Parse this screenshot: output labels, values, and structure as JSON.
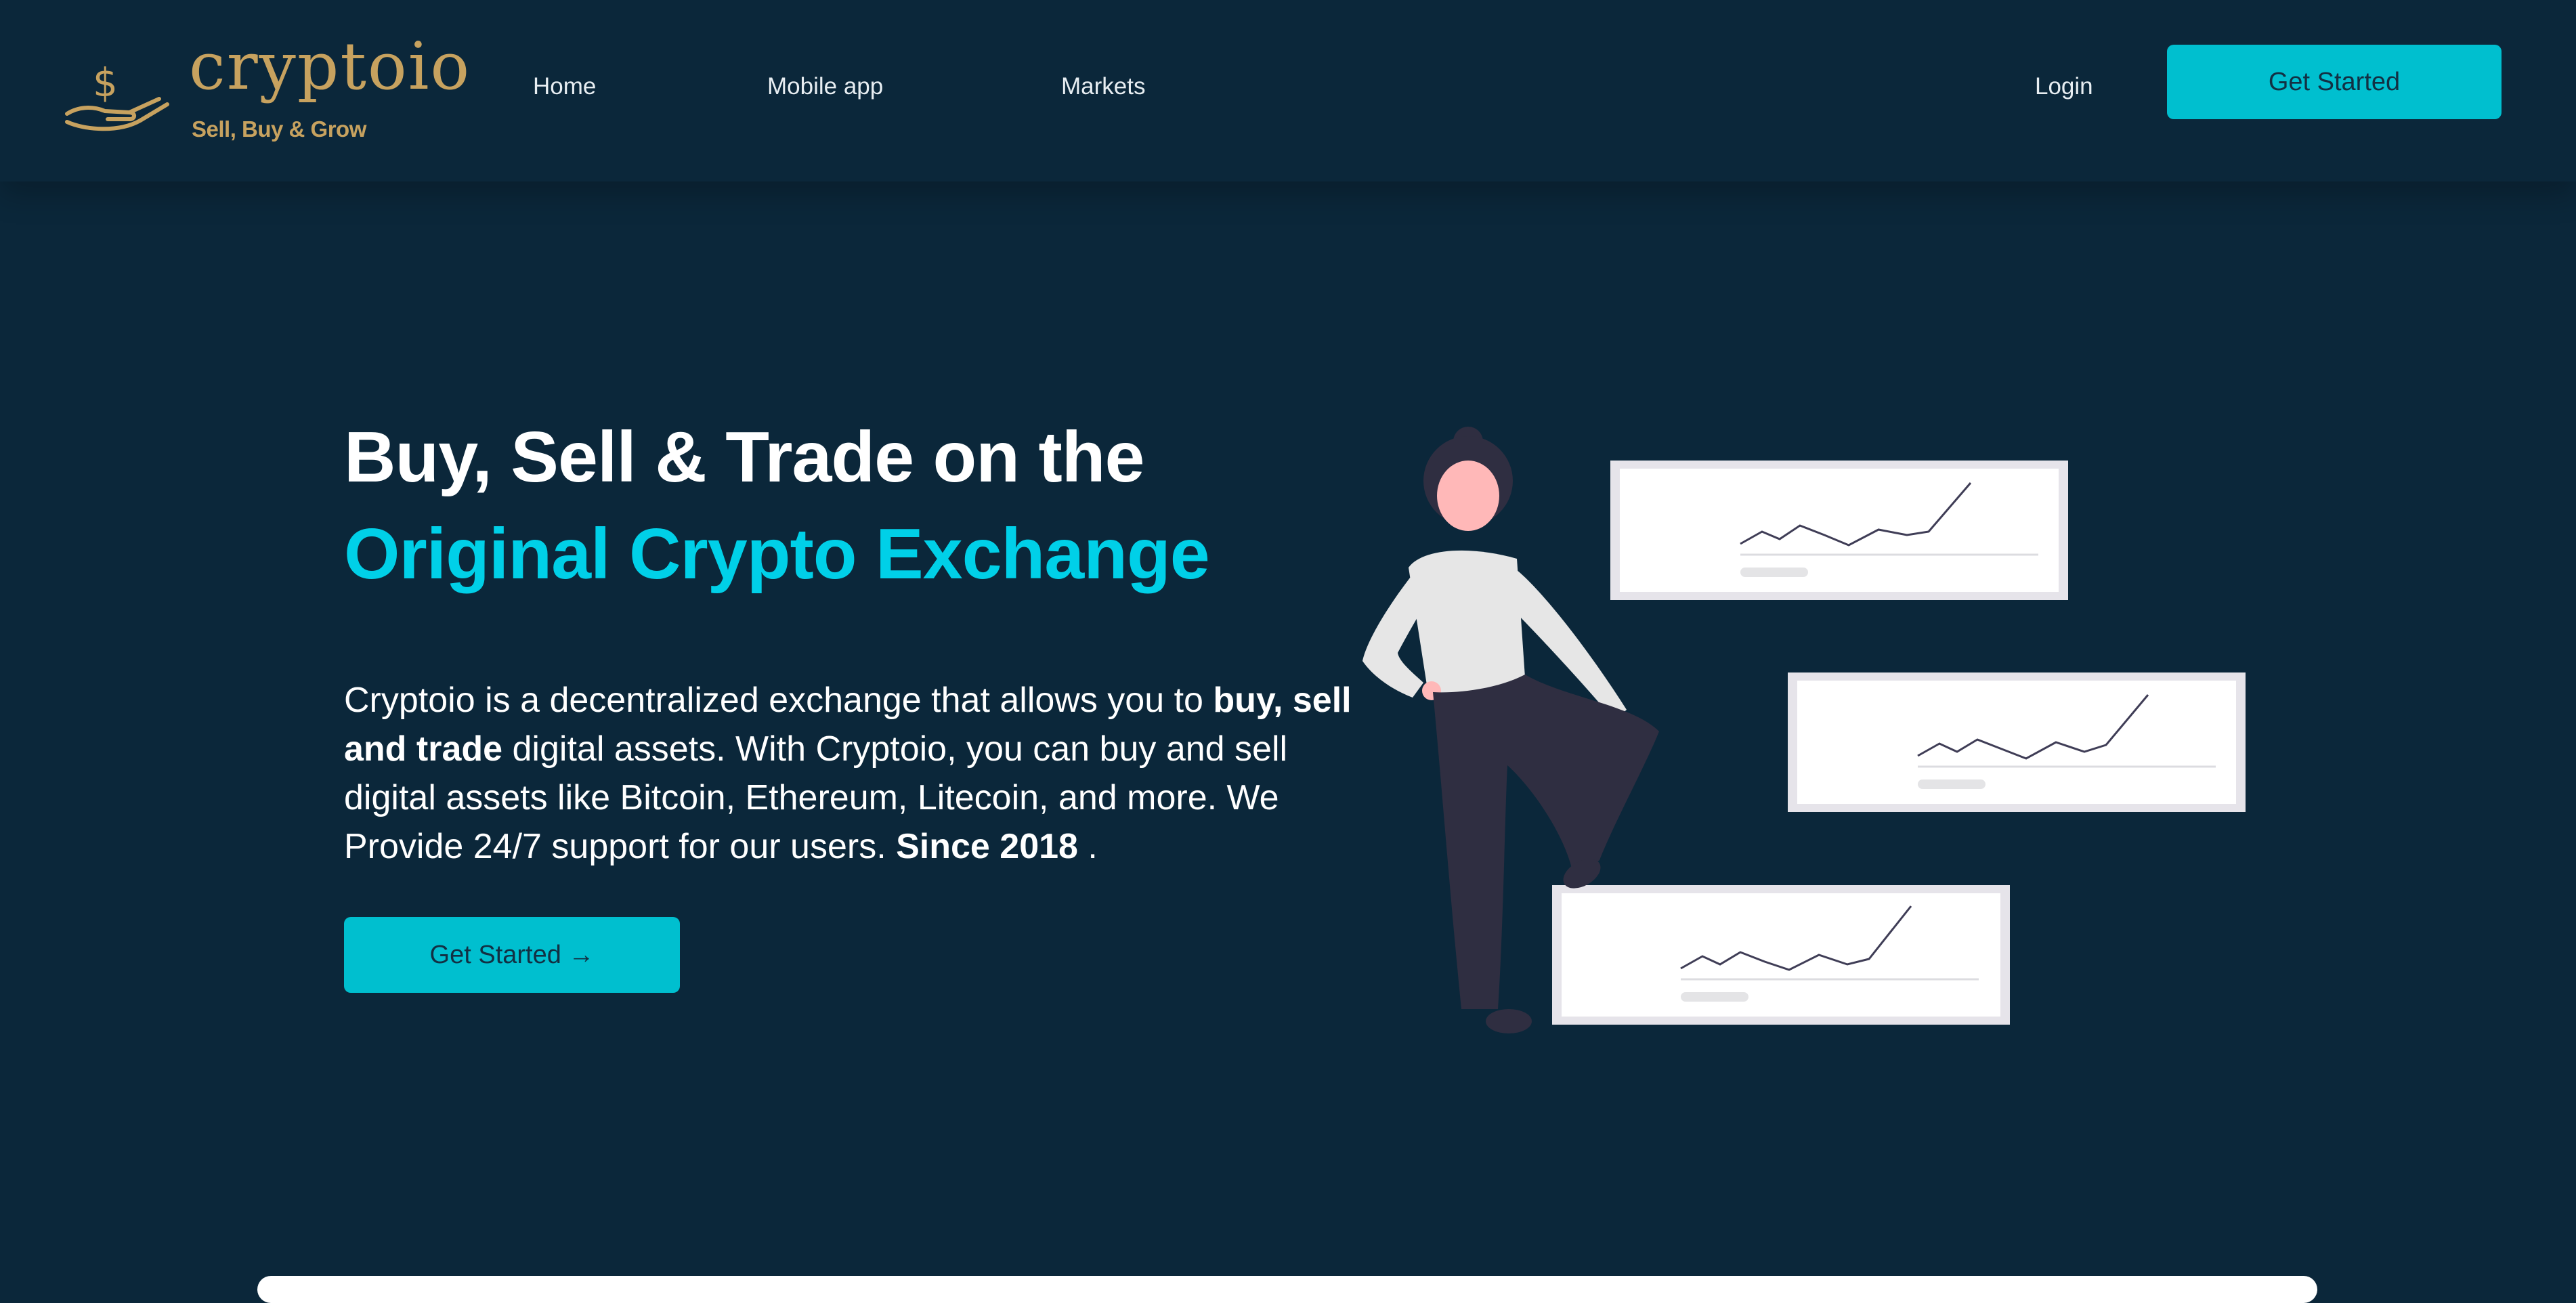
{
  "header": {
    "logo": {
      "wordmark": "cryptoio",
      "tagline": "Sell, Buy & Grow",
      "icon": "hand-dollar-icon",
      "color": "#c7a25f"
    },
    "nav": [
      {
        "label": "Home"
      },
      {
        "label": "Mobile app"
      },
      {
        "label": "Markets"
      }
    ],
    "login_label": "Login",
    "cta_label": "Get Started"
  },
  "hero": {
    "title_line1": "Buy, Sell & Trade on the",
    "title_line2": "Original Crypto Exchange",
    "para": {
      "part1": "Cryptoio is a decentralized exchange that allows you to ",
      "bold1": "buy, sell and trade",
      "part2": " digital assets. With Cryptoio, you can buy and sell digital assets like Bitcoin, Ethereum, Litecoin, and more. We Provide 24/7 support for our users. ",
      "bold2": "Since 2018",
      "part3": " ."
    },
    "cta_label": "Get Started →"
  },
  "illustration": {
    "subject": "woman-with-charts",
    "chart_cards": 3
  },
  "colors": {
    "background": "#0b273a",
    "accent": "#00bfcf",
    "highlight": "#00d0e8"
  }
}
